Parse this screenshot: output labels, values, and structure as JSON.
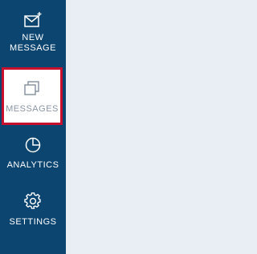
{
  "sidebar": {
    "items": [
      {
        "id": "new-message",
        "label": "NEW\nMESSAGE",
        "label_lines": [
          "NEW",
          "MESSAGE"
        ],
        "icon": "envelope-plus-icon"
      },
      {
        "id": "messages",
        "label": "MESSAGES",
        "icon": "stacked-squares-icon",
        "state": "selected"
      },
      {
        "id": "analytics",
        "label": "ANALYTICS",
        "icon": "pie-chart-icon"
      },
      {
        "id": "settings",
        "label": "SETTINGS",
        "icon": "gear-icon"
      }
    ]
  },
  "colors": {
    "sidebar_bg": "#0b4570",
    "content_bg": "#e8eef4",
    "selected_bg": "#ffffff",
    "selected_border": "#c8102e",
    "selected_text": "#8a96a3",
    "nav_text": "#ffffff"
  }
}
